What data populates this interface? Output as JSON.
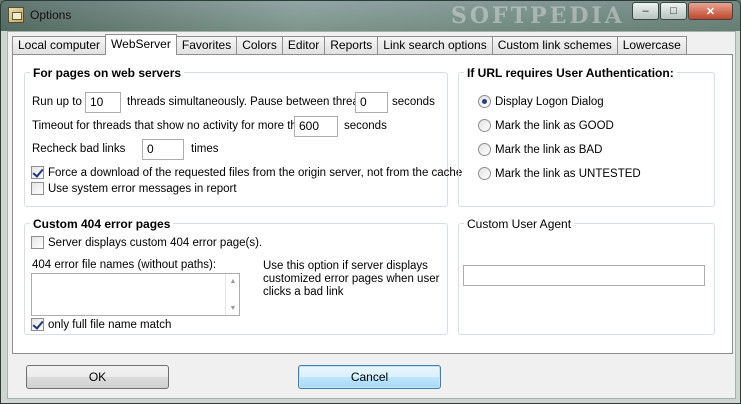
{
  "window": {
    "title": "Options",
    "watermark": "SOFTPEDIA"
  },
  "caption": {
    "minimize": "–",
    "maximize": "□",
    "close": "✕"
  },
  "tabs": [
    "Local computer",
    "WebServer",
    "Favorites",
    "Colors",
    "Editor",
    "Reports",
    "Link search options",
    "Custom link schemes",
    "Lowercase"
  ],
  "active_tab": "WebServer",
  "web_servers": {
    "title": "For pages on web servers",
    "run_up_to_label": "Run up to",
    "threads_value": "10",
    "threads_label": "threads simultaneously. Pause between threads",
    "pause_value": "0",
    "seconds_label": "seconds",
    "timeout_label": "Timeout for threads that show no activity for more than",
    "timeout_value": "600",
    "timeout_seconds_label": "seconds",
    "recheck_label": "Recheck bad links",
    "recheck_value": "0",
    "times_label": "times",
    "force_download_label": "Force a download of the requested files from the origin server, not from the cache",
    "force_download_checked": true,
    "system_errors_label": "Use system error messages in report",
    "system_errors_checked": false
  },
  "custom_404": {
    "title": "Custom 404 error pages",
    "server_displays_label": "Server displays custom 404 error page(s).",
    "server_displays_checked": false,
    "file_names_label": "404 error file names (without paths):",
    "file_names_value": "",
    "hint": "Use this option if server displays customized error pages when user clicks a bad link",
    "full_match_label": "only full file name match",
    "full_match_checked": true
  },
  "auth": {
    "title": "If URL requires User Authentication:",
    "options": [
      "Display Logon Dialog",
      "Mark the link as GOOD",
      "Mark the link as BAD",
      "Mark the link as UNTESTED"
    ],
    "selected": "Display Logon Dialog"
  },
  "user_agent": {
    "title": "Custom User Agent",
    "value": ""
  },
  "buttons": {
    "ok": "OK",
    "cancel": "Cancel"
  }
}
